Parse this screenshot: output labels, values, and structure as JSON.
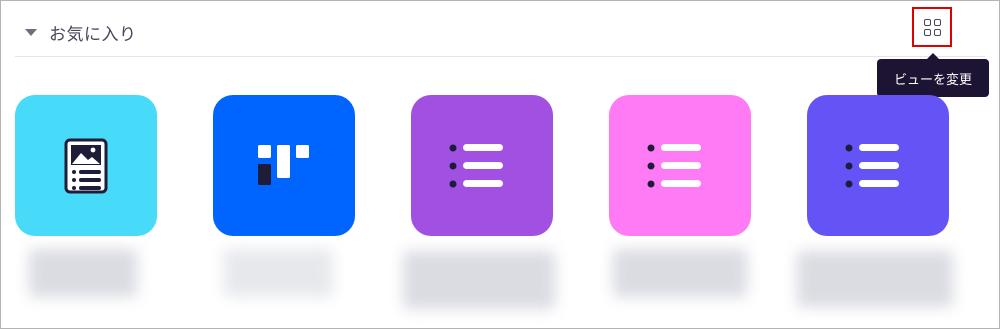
{
  "section": {
    "title": "お気に入り"
  },
  "view_button": {
    "icon": "grid-view-icon",
    "tooltip": "ビューを変更"
  },
  "tiles": [
    {
      "color": "#48daf9",
      "icon": "document-image-icon"
    },
    {
      "color": "#0065ff",
      "icon": "board-icon"
    },
    {
      "color": "#a250e2",
      "icon": "list-icon"
    },
    {
      "color": "#ff7af5",
      "icon": "list-icon"
    },
    {
      "color": "#6554f5",
      "icon": "list-icon"
    }
  ]
}
